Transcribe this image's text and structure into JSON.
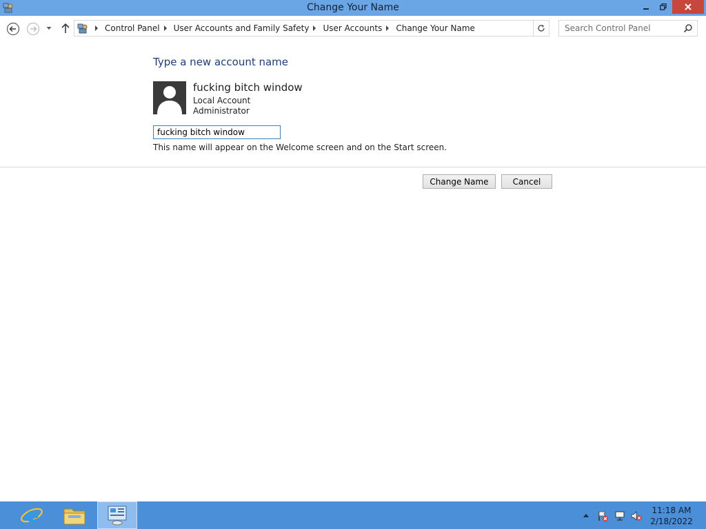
{
  "window": {
    "title": "Change Your Name"
  },
  "address_bar": {
    "breadcrumbs": [
      "Control Panel",
      "User Accounts and Family Safety",
      "User Accounts",
      "Change Your Name"
    ]
  },
  "search": {
    "placeholder": "Search Control Panel"
  },
  "content": {
    "heading": "Type a new account name",
    "account": {
      "name": "fucking bitch window",
      "type": "Local Account",
      "role": "Administrator"
    },
    "name_input_value": "fucking bitch window",
    "hint": "This name will appear on the Welcome screen and on the Start screen.",
    "buttons": {
      "change": "Change Name",
      "cancel": "Cancel"
    }
  },
  "taskbar": {
    "apps": [
      "internet-explorer-icon",
      "file-explorer-icon",
      "control-panel-icon"
    ],
    "tray_icons": [
      "show-hidden-icons-icon",
      "action-center-flag-icon",
      "network-icon",
      "volume-muted-icon"
    ],
    "clock": {
      "time": "11:18 AM",
      "date": "2/18/2022"
    }
  },
  "colors": {
    "titlebar": "#6aa5e6",
    "taskbar": "#4a8fd8",
    "close_button": "#c7473c",
    "heading": "#1e3c78"
  }
}
